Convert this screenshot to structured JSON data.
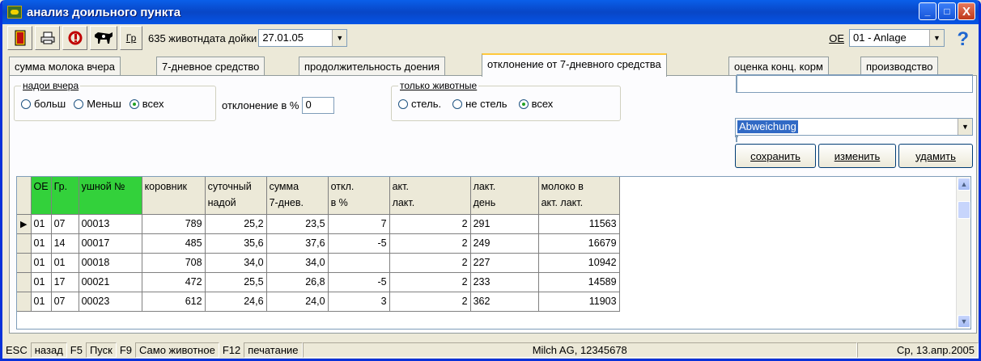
{
  "window": {
    "title": "анализ доильного пункта",
    "buttons": {
      "minimize": "_",
      "maximize": "□",
      "close": "X"
    }
  },
  "toolbar": {
    "gr_label": "Гр",
    "animal_count": "635 животн",
    "date_label": "дата дойки",
    "date_value": "27.01.05",
    "oe_label": "OE",
    "oe_value": "01 - Anlage",
    "help_symbol": "?"
  },
  "tabs": [
    {
      "label": "сумма молока вчера"
    },
    {
      "label": "7-дневное средство"
    },
    {
      "label": "продолжительность доения"
    },
    {
      "label": "отклонение от 7-дневного средства"
    },
    {
      "label": "оценка конц. корм"
    },
    {
      "label": "производство"
    }
  ],
  "filters": {
    "yield_group_title": "надои вчера",
    "yield_options": [
      "больш",
      "Меньш",
      "всех"
    ],
    "deviation_label": "отклонение в %",
    "deviation_value": "0",
    "animals_group_title": "только животные",
    "animals_options": [
      "стель.",
      "не стель",
      "всех"
    ]
  },
  "preset": {
    "value": "Abweichung",
    "save_label": "сохранить",
    "change_label": "изменить",
    "delete_label": "удамить"
  },
  "grid": {
    "headers": [
      [
        "OE",
        ""
      ],
      [
        "Гр.",
        ""
      ],
      [
        "ушной №",
        ""
      ],
      [
        "коровник",
        ""
      ],
      [
        "суточный",
        "надой"
      ],
      [
        "сумма",
        "7-днев."
      ],
      [
        "откл.",
        "в %"
      ],
      [
        "акт.",
        "лакт."
      ],
      [
        "лакт.",
        "день"
      ],
      [
        "молоко в",
        "акт. лакт."
      ]
    ],
    "rows": [
      [
        "01",
        "07",
        "00013",
        "789",
        "25,2",
        "23,5",
        "7",
        "2",
        "291",
        "11563"
      ],
      [
        "01",
        "14",
        "00017",
        "485",
        "35,6",
        "37,6",
        "-5",
        "2",
        "249",
        "16679"
      ],
      [
        "01",
        "01",
        "00018",
        "708",
        "34,0",
        "34,0",
        "",
        "2",
        "227",
        "10942"
      ],
      [
        "01",
        "17",
        "00021",
        "472",
        "25,5",
        "26,8",
        "-5",
        "2",
        "233",
        "14589"
      ],
      [
        "01",
        "07",
        "00023",
        "612",
        "24,6",
        "24,0",
        "3",
        "2",
        "362",
        "11903"
      ]
    ],
    "row_marker": "▶"
  },
  "statusbar": {
    "esc": "ESC",
    "back": "назад",
    "f5": "F5",
    "start": "Пуск",
    "f9": "F9",
    "animal": "Само животное",
    "f12": "F12",
    "print": "печатание",
    "company": "Milch AG, 12345678",
    "date": "Ср, 13.апр.2005"
  }
}
